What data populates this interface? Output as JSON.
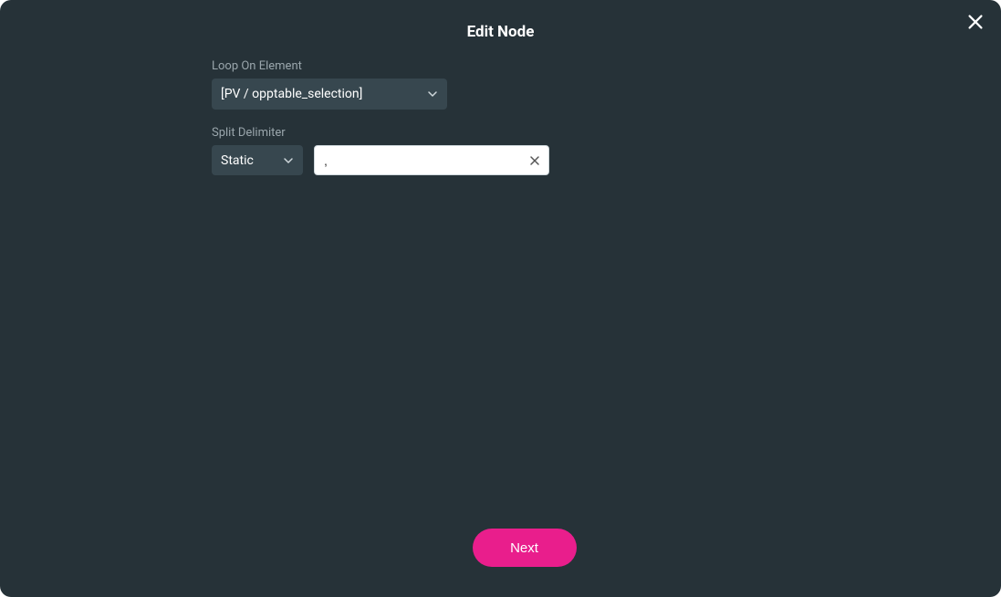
{
  "modal": {
    "title": "Edit Node"
  },
  "form": {
    "loopLabel": "Loop On Element",
    "loopValue": "[PV / opptable_selection]",
    "splitLabel": "Split Delimiter",
    "splitTypeValue": "Static",
    "splitDelimiterValue": ","
  },
  "actions": {
    "nextLabel": "Next"
  }
}
